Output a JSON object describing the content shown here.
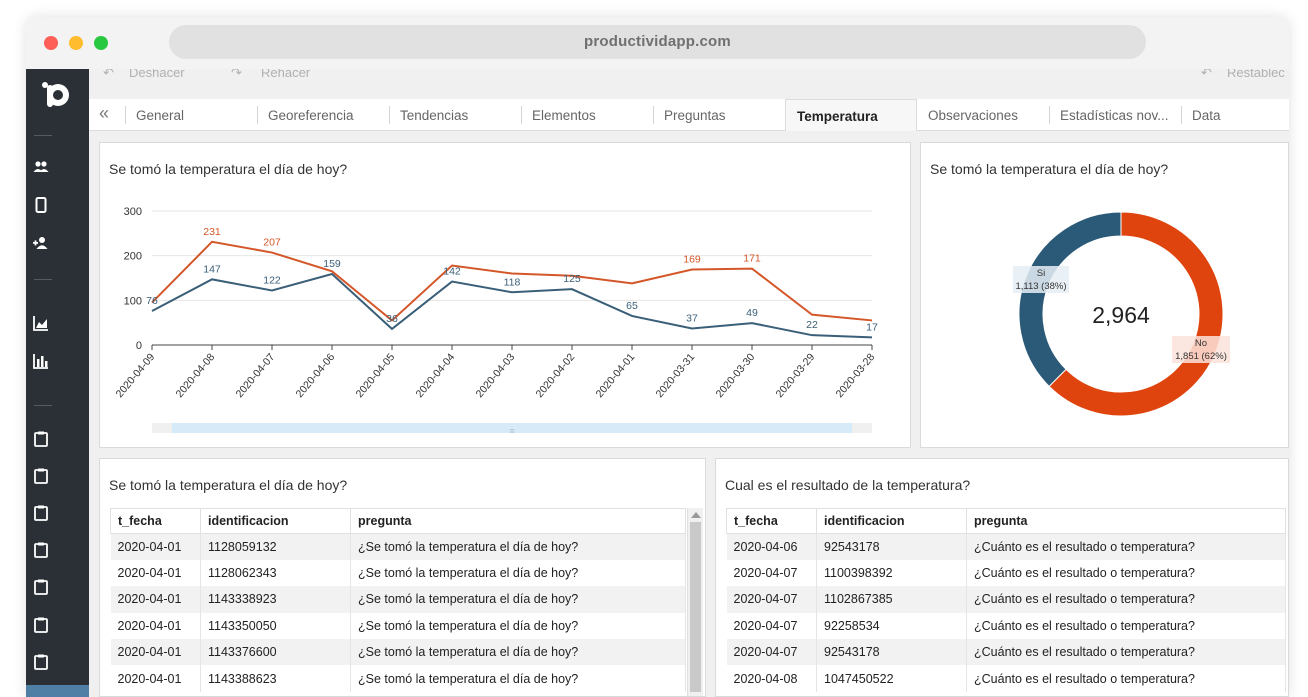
{
  "browser": {
    "url": "productividapp.com"
  },
  "toolbar": {
    "undo_label": "Deshacer",
    "redo_label": "Rehacer",
    "reset_label": "Restablec"
  },
  "tabs": [
    {
      "label": "General"
    },
    {
      "label": "Georeferencia"
    },
    {
      "label": "Tendencias"
    },
    {
      "label": "Elementos"
    },
    {
      "label": "Preguntas"
    },
    {
      "label": "Temperatura"
    },
    {
      "label": "Observaciones"
    },
    {
      "label": "Estadísticas nov..."
    },
    {
      "label": "Data"
    }
  ],
  "active_tab": "Temperatura",
  "line_panel": {
    "title": "Se tomó la temperatura el día de hoy?"
  },
  "donut_panel": {
    "title": "Se tomó la temperatura el día de hoy?",
    "total_label": "2,964"
  },
  "table1": {
    "title": "Se tomó la temperatura el día de hoy?",
    "columns": [
      "t_fecha",
      "identificacion",
      "pregunta"
    ],
    "rows": [
      [
        "2020-04-01",
        "1128059132",
        "¿Se tomó la temperatura el día de hoy?"
      ],
      [
        "2020-04-01",
        "1128062343",
        "¿Se tomó la temperatura el día de hoy?"
      ],
      [
        "2020-04-01",
        "1143338923",
        "¿Se tomó la temperatura el día de hoy?"
      ],
      [
        "2020-04-01",
        "1143350050",
        "¿Se tomó la temperatura el día de hoy?"
      ],
      [
        "2020-04-01",
        "1143376600",
        "¿Se tomó la temperatura el día de hoy?"
      ],
      [
        "2020-04-01",
        "1143388623",
        "¿Se tomó la temperatura el día de hoy?"
      ]
    ]
  },
  "table2": {
    "title": "Cual es el resultado de la temperatura?",
    "columns": [
      "t_fecha",
      "identificacion",
      "pregunta"
    ],
    "rows": [
      [
        "2020-04-06",
        "92543178",
        "¿Cuánto es el resultado o temperatura?"
      ],
      [
        "2020-04-07",
        "1100398392",
        "¿Cuánto es el resultado o temperatura?"
      ],
      [
        "2020-04-07",
        "1102867385",
        "¿Cuánto es el resultado o temperatura?"
      ],
      [
        "2020-04-07",
        "92258534",
        "¿Cuánto es el resultado o temperatura?"
      ],
      [
        "2020-04-07",
        "92543178",
        "¿Cuánto es el resultado o temperatura?"
      ],
      [
        "2020-04-08",
        "1047450522",
        "¿Cuánto es el resultado o temperatura?"
      ]
    ]
  },
  "colors": {
    "orange": "#d4572a",
    "blue": "#3a5f78",
    "donut_orange": "#e0440e",
    "donut_blue": "#2a5a78"
  },
  "sidebar_icons": [
    "users-icon",
    "phone-icon",
    "user-add-icon",
    "area-chart-icon",
    "bar-chart-icon",
    "clipboard-icon",
    "clipboard-icon",
    "clipboard-icon",
    "clipboard-icon",
    "clipboard-icon",
    "clipboard-icon",
    "clipboard-icon"
  ],
  "chart_data": [
    {
      "type": "line",
      "x": [
        "2020-04-09",
        "2020-04-08",
        "2020-04-07",
        "2020-04-06",
        "2020-04-05",
        "2020-04-04",
        "2020-04-03",
        "2020-04-02",
        "2020-04-01",
        "2020-03-31",
        "2020-03-30",
        "2020-03-29",
        "2020-03-28"
      ],
      "series": [
        {
          "values": [
            95,
            231,
            207,
            165,
            55,
            178,
            160,
            155,
            138,
            169,
            171,
            68,
            55
          ],
          "data_labels": [
            "",
            "231",
            "207",
            "",
            "",
            "",
            "",
            "",
            "",
            "169",
            "171",
            "",
            ""
          ]
        },
        {
          "values": [
            76,
            147,
            122,
            159,
            36,
            142,
            118,
            125,
            65,
            37,
            49,
            22,
            17
          ],
          "data_labels": [
            "76",
            "147",
            "122",
            "159",
            "36",
            "142",
            "118",
            "125",
            "65",
            "37",
            "49",
            "22",
            "17"
          ]
        }
      ],
      "yticks": [
        "0",
        "100",
        "200",
        "300"
      ],
      "ylim": [
        0,
        300
      ],
      "grid": true
    },
    {
      "type": "pie",
      "categories": [
        "Si",
        "No"
      ],
      "values": [
        1113,
        1851
      ],
      "slice_labels": [
        "1,113 (38%)",
        "1,851 (62%)"
      ]
    }
  ]
}
